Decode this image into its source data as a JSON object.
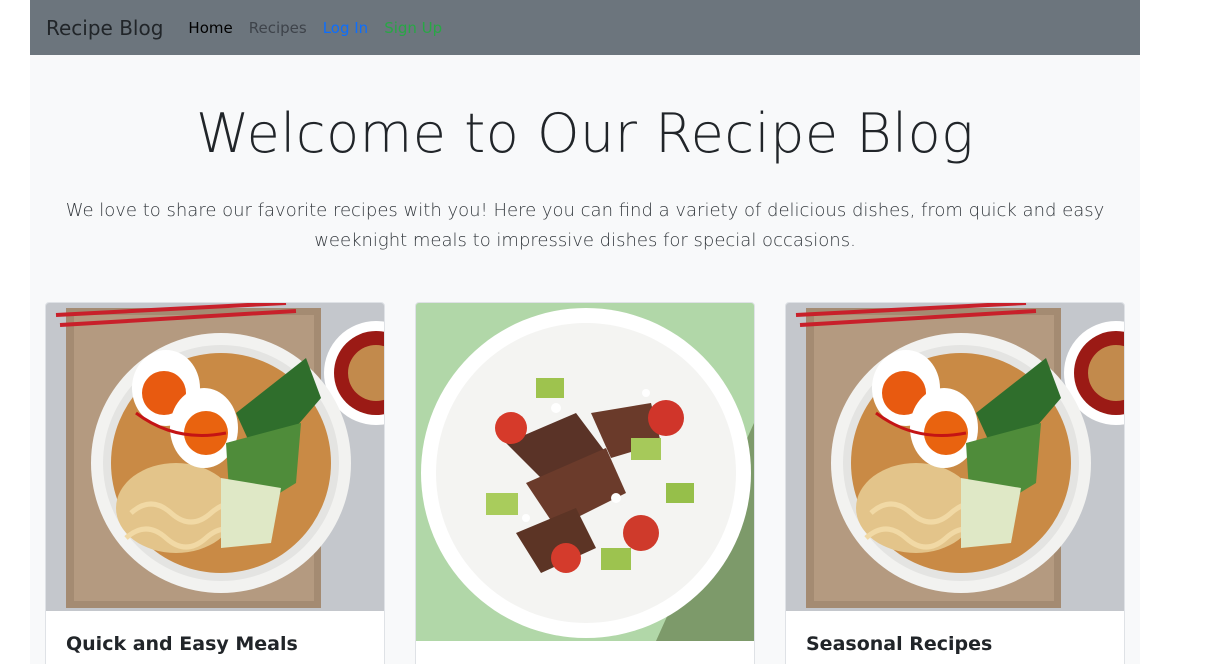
{
  "nav": {
    "brand": "Recipe Blog",
    "links": [
      {
        "label": "Home",
        "color": "#000000"
      },
      {
        "label": "Recipes",
        "color": "#3e434a"
      },
      {
        "label": "Log In",
        "color": "#0d6efd"
      },
      {
        "label": "Sign Up",
        "color": "#28a745"
      }
    ],
    "background": "#6c757d"
  },
  "hero": {
    "title": "Welcome to Our Recipe Blog",
    "text": "We love to share our favorite recipes with you! Here you can find a variety of delicious dishes, from quick and easy weeknight meals to impressive dishes for special occasions."
  },
  "cards": [
    {
      "title": "Quick and Easy Meals",
      "image": "ramen-bowl-photo"
    },
    {
      "title": "",
      "image": "steak-salad-photo"
    },
    {
      "title": "Seasonal Recipes",
      "image": "ramen-bowl-photo"
    }
  ],
  "colors": {
    "page_background": "#f8f9fa",
    "card_background": "#ffffff"
  }
}
